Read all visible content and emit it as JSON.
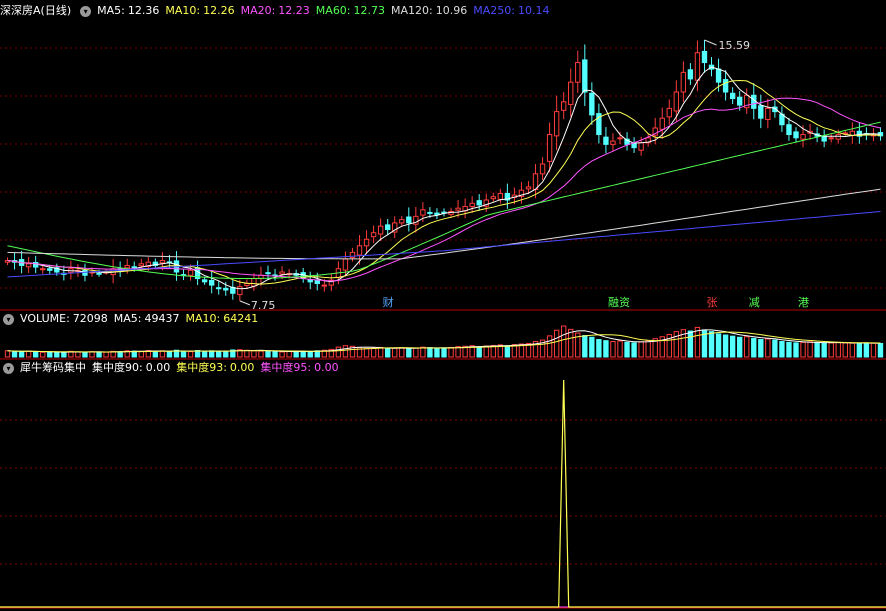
{
  "colors": {
    "up": "#ff3c3c",
    "down": "#54ffff",
    "ma5": "#ffffff",
    "ma10": "#ffff54",
    "ma20": "#ff54ff",
    "ma60": "#54ff54",
    "ma120": "#dddddd",
    "ma250": "#4a4aff",
    "grid": "#7a0000",
    "sep": "#b40000"
  },
  "price_panel": {
    "stock_name": "深深房A",
    "period": "(日线)",
    "ma": [
      {
        "key": "ma5",
        "label": "MA5:",
        "value": "12.36"
      },
      {
        "key": "ma10",
        "label": "MA10:",
        "value": "12.26"
      },
      {
        "key": "ma20",
        "label": "MA20:",
        "value": "12.23"
      },
      {
        "key": "ma60",
        "label": "MA60:",
        "value": "12.73"
      },
      {
        "key": "ma120",
        "label": "MA120:",
        "value": "10.96"
      },
      {
        "key": "ma250",
        "label": "MA250:",
        "value": "10.14"
      }
    ],
    "high_label": "15.59",
    "low_label": "7.75",
    "event_markers": [
      {
        "text": "财",
        "color": "#54a8ff"
      },
      {
        "text": "融资",
        "color": "#54ff54"
      },
      {
        "text": "张",
        "color": "#ff3c3c"
      },
      {
        "text": "减",
        "color": "#54ff54"
      },
      {
        "text": "港",
        "color": "#54ff54"
      }
    ]
  },
  "volume_panel": {
    "name": "VOLUME:",
    "value": "72098",
    "ma5_label": "MA5:",
    "ma5_value": "49437",
    "ma10_label": "MA10:",
    "ma10_value": "64241"
  },
  "indicator_panel": {
    "name": "犀牛筹码集中",
    "l90": "集中度90:",
    "v90": "0.00",
    "l93": "集中度93:",
    "v93": "0.00",
    "l95": "集中度95:",
    "v95": "0.00"
  },
  "chart_data": [
    {
      "type": "candlestick",
      "title": "",
      "low_annotation": 7.75,
      "high_annotation": 15.59,
      "ylim": [
        7.3,
        16.1
      ],
      "grid": true,
      "closes": [
        8.75,
        8.7,
        8.6,
        8.65,
        8.55,
        8.5,
        8.45,
        8.4,
        8.35,
        8.5,
        8.45,
        8.3,
        8.4,
        8.35,
        8.4,
        8.5,
        8.45,
        8.6,
        8.55,
        8.65,
        8.7,
        8.6,
        8.75,
        8.7,
        8.4,
        8.3,
        8.45,
        8.2,
        8.1,
        8.0,
        7.9,
        7.85,
        7.75,
        7.95,
        8.05,
        8.2,
        8.3,
        8.35,
        8.3,
        8.4,
        8.35,
        8.3,
        8.2,
        8.1,
        8.05,
        8.0,
        8.15,
        8.5,
        8.8,
        9.0,
        9.2,
        9.4,
        9.6,
        9.8,
        9.7,
        9.9,
        10.0,
        9.9,
        10.1,
        10.3,
        10.2,
        10.15,
        10.2,
        10.25,
        10.35,
        10.4,
        10.5,
        10.45,
        10.6,
        10.7,
        10.8,
        10.6,
        10.75,
        10.9,
        11.0,
        11.4,
        11.7,
        12.6,
        13.3,
        13.6,
        14.2,
        14.8,
        13.9,
        13.2,
        12.6,
        12.3,
        12.4,
        12.5,
        12.3,
        12.2,
        12.35,
        12.5,
        12.8,
        13.1,
        13.4,
        13.9,
        14.5,
        14.3,
        15.1,
        14.8,
        14.6,
        14.2,
        13.9,
        13.7,
        13.5,
        13.8,
        13.4,
        13.1,
        13.4,
        13.3,
        12.9,
        12.6,
        12.5,
        12.6,
        12.7,
        12.55,
        12.4,
        12.5,
        12.6,
        12.65,
        12.7,
        12.55,
        12.6,
        12.62,
        12.56
      ],
      "volume": [
        22,
        20,
        19,
        21,
        18,
        17,
        18,
        16,
        17,
        20,
        18,
        17,
        19,
        18,
        17,
        20,
        19,
        22,
        21,
        20,
        23,
        20,
        22,
        19,
        24,
        21,
        19,
        23,
        20,
        22,
        21,
        19,
        25,
        26,
        24,
        22,
        21,
        20,
        19,
        18,
        20,
        19,
        21,
        20,
        22,
        24,
        27,
        35,
        40,
        38,
        33,
        30,
        32,
        34,
        29,
        31,
        33,
        30,
        32,
        35,
        33,
        31,
        32,
        34,
        37,
        38,
        40,
        36,
        39,
        41,
        43,
        40,
        44,
        46,
        48,
        55,
        60,
        75,
        95,
        110,
        98,
        85,
        76,
        70,
        62,
        58,
        55,
        57,
        52,
        50,
        54,
        58,
        65,
        72,
        80,
        90,
        97,
        92,
        105,
        96,
        90,
        82,
        78,
        74,
        70,
        72,
        66,
        62,
        64,
        60,
        55,
        52,
        50,
        52,
        54,
        51,
        49,
        50,
        52,
        50,
        49,
        48,
        50,
        49,
        48
      ],
      "indicator_spike_index": 79
    }
  ]
}
